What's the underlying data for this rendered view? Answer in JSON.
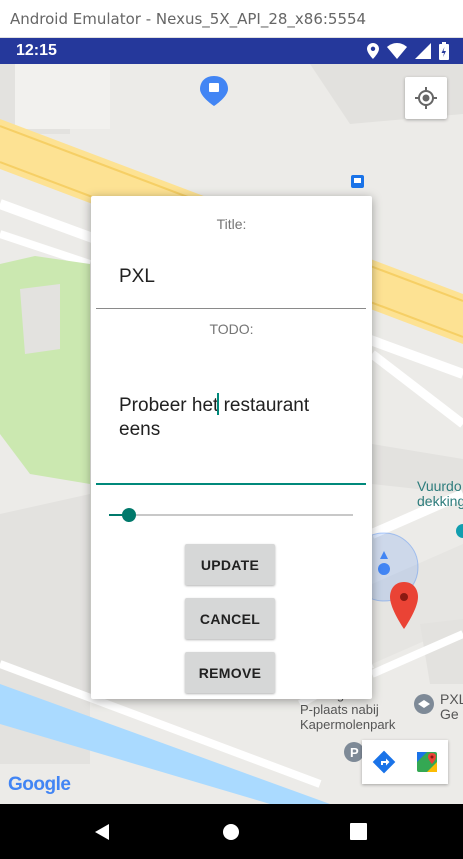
{
  "window": {
    "title": "Android Emulator - Nexus_5X_API_28_x86:5554"
  },
  "status_bar": {
    "time": "12:15",
    "icons": [
      "location-icon",
      "wifi-icon",
      "signal-icon",
      "battery-icon"
    ]
  },
  "map": {
    "labels": {
      "poi1_line1": "Vuurdo",
      "poi1_line2": "dekkingsfesti",
      "parking_line1": "Parking Lot",
      "parking_line2": "P-plaats nabij",
      "parking_line3": "Kapermolenpark",
      "pxl_line1": "PXL",
      "pxl_line2": "Ge"
    },
    "logo": "Google",
    "colors": {
      "background": "#ecebe8",
      "road": "#fde293",
      "park": "#cbe8b0",
      "water": "#aadaff",
      "marker": "#ea4335"
    }
  },
  "dialog": {
    "title_label": "Title:",
    "title_value": "PXL",
    "todo_label": "TODO:",
    "todo_before_cursor": "Probeer het",
    "todo_after_cursor": " restaurant eens",
    "slider_value": 0.08,
    "buttons": {
      "update": "UPDATE",
      "cancel": "CANCEL",
      "remove": "REMOVE"
    },
    "accent_color": "#00897b"
  },
  "nav_bar": {
    "buttons": [
      "back-icon",
      "home-icon",
      "recents-icon"
    ]
  }
}
